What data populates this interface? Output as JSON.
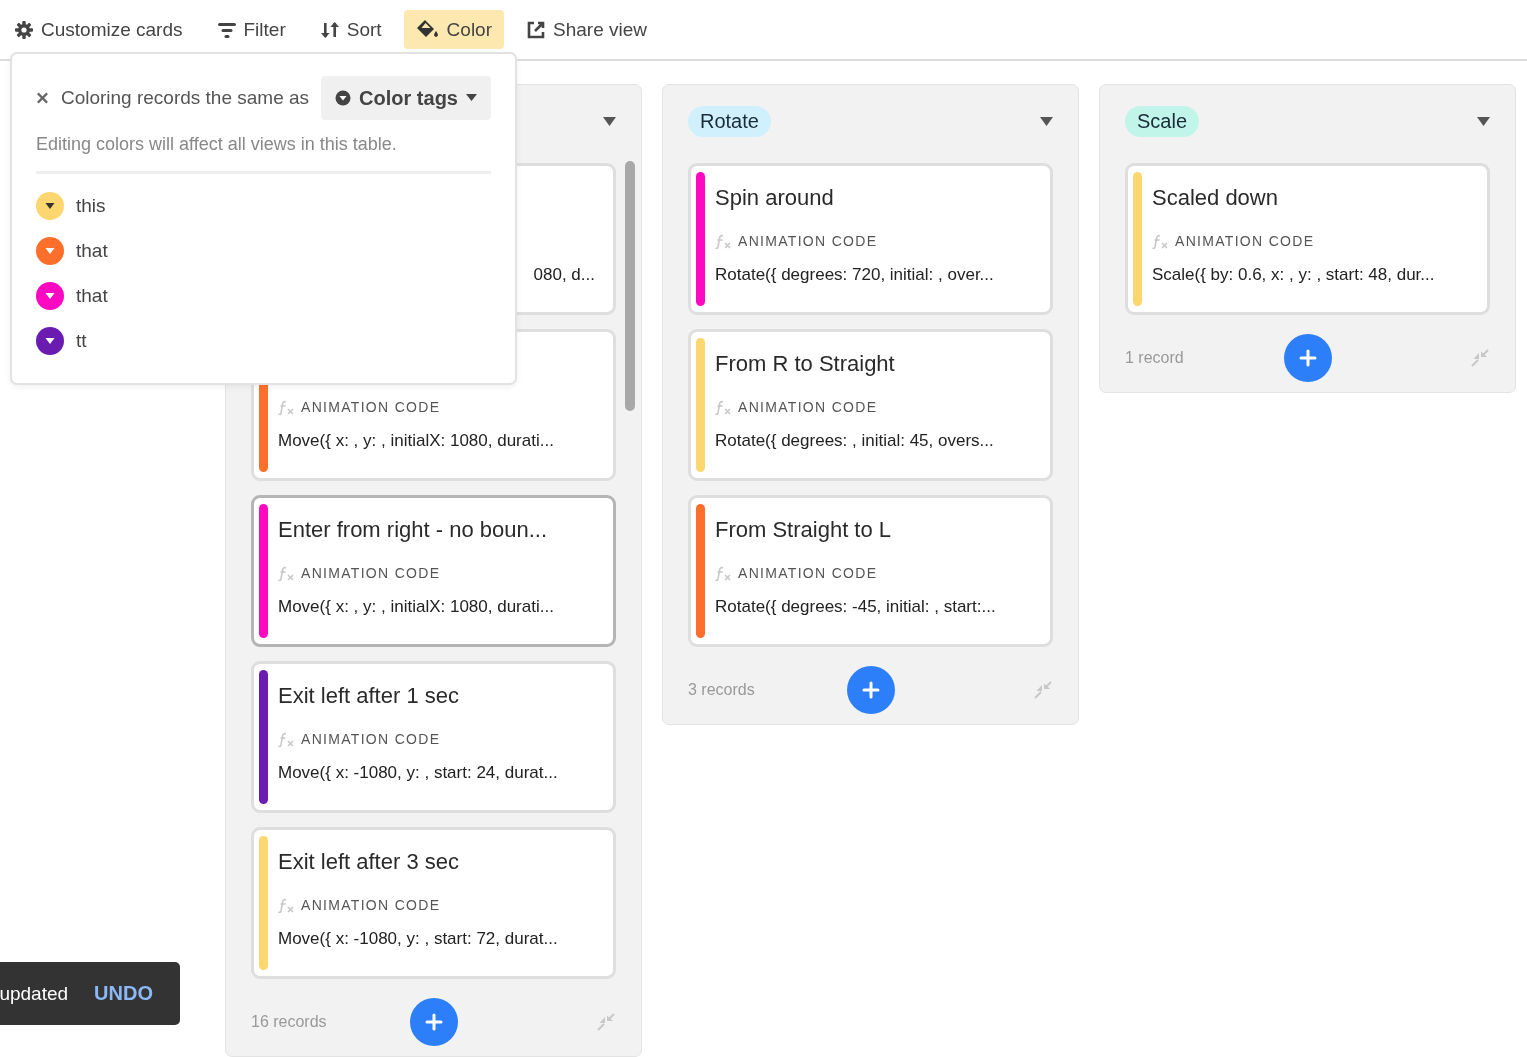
{
  "toolbar": [
    {
      "kind": "gear",
      "label": "Customize cards",
      "selected": false
    },
    {
      "kind": "filter",
      "label": "Filter",
      "selected": false
    },
    {
      "kind": "sort",
      "label": "Sort",
      "selected": false
    },
    {
      "kind": "color",
      "label": "Color",
      "selected": true
    },
    {
      "kind": "share",
      "label": "Share view",
      "selected": false
    }
  ],
  "color_popup": {
    "label": "Coloring records the same as",
    "dropdown": "Color tags",
    "note": "Editing colors will affect all views in this table.",
    "tags": [
      {
        "name": "this",
        "color": "#fcd66e"
      },
      {
        "name": "that",
        "color": "#ff6f2c"
      },
      {
        "name": "that",
        "color": "#ff08c2"
      },
      {
        "name": "tt",
        "color": "#6b1cb0"
      }
    ]
  },
  "columns": [
    {
      "scrollable": true,
      "cards": [
        {
          "code": "080, d...",
          "selected": false
        },
        {
          "field_label": "ANIMATION CODE",
          "code": "Move({ x: , y: , initialX: 1080, durati...",
          "color": "#ff6f2c",
          "selected": false
        },
        {
          "title": "Enter from right - no boun...",
          "field_label": "ANIMATION CODE",
          "code": "Move({ x: , y: , initialX: 1080, durati...",
          "color": "#ff08c2",
          "selected": true
        },
        {
          "title": "Exit left after 1 sec",
          "field_label": "ANIMATION CODE",
          "code": "Move({ x: -1080, y: , start: 24, durat...",
          "color": "#6b1cb0",
          "selected": false
        },
        {
          "title": "Exit left after 3 sec",
          "field_label": "ANIMATION CODE",
          "code": "Move({ x: -1080, y: , start: 72, durat...",
          "color": "#fcd66e",
          "selected": false
        }
      ],
      "count": "16 records"
    },
    {
      "tag": "Rotate",
      "color": "#d0f0fd",
      "scrollable": false,
      "cards": [
        {
          "title": "Spin around",
          "field_label": "ANIMATION CODE",
          "code": "Rotate({ degrees: 720, initial: , over...",
          "color": "#ff08c2",
          "selected": false
        },
        {
          "title": "From R to Straight",
          "field_label": "ANIMATION CODE",
          "code": "Rotate({ degrees: , initial: 45, overs...",
          "color": "#fcd66e",
          "selected": false
        },
        {
          "title": "From Straight to L",
          "field_label": "ANIMATION CODE",
          "code": "Rotate({ degrees: -45, initial: , start:...",
          "color": "#ff6f2c",
          "selected": false
        }
      ],
      "count": "3 records"
    },
    {
      "tag": "Scale",
      "color": "#c2f5e9",
      "scrollable": false,
      "cards": [
        {
          "title": "Scaled down",
          "field_label": "ANIMATION CODE",
          "code": "Scale({ by: 0.6, x: , y: , start: 48, dur...",
          "color": "#fcd66e",
          "selected": false
        }
      ],
      "count": "1 record"
    }
  ],
  "toast": {
    "message": "updated",
    "action": "UNDO"
  }
}
